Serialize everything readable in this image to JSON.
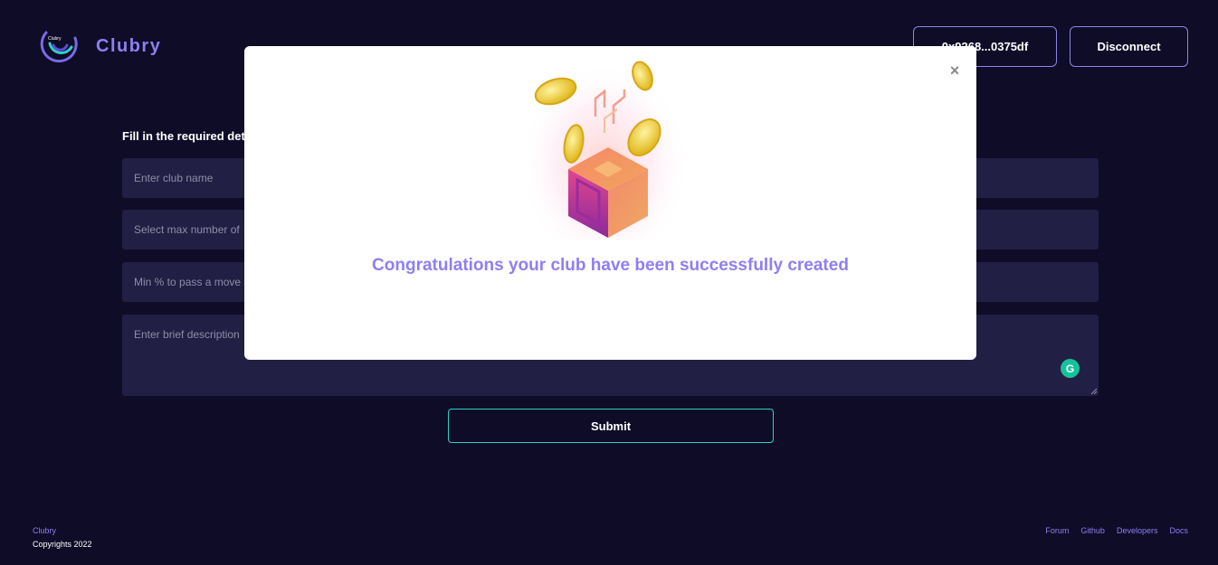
{
  "header": {
    "brand": "Clubry",
    "logo_text": "Clubry",
    "wallet_label": "0x9268...0375df",
    "disconnect_label": "Disconnect"
  },
  "form": {
    "heading": "Fill in the required deta",
    "club_name_placeholder": "Enter club name",
    "max_members_placeholder": "Select max number of",
    "min_percent_placeholder": "Min % to pass a move s",
    "description_placeholder": "Enter brief description",
    "submit_label": "Submit"
  },
  "modal": {
    "close_symbol": "×",
    "message": "Congratulations your club have been successfully created"
  },
  "footer": {
    "brand": "Clubry",
    "copyright": "Copyrights 2022",
    "links": [
      "Forum",
      "Github",
      "Developers",
      "Docs"
    ]
  },
  "colors": {
    "background": "#0e0c27",
    "accent": "#8e7ff2",
    "field": "#221f45",
    "submit_border": "#2fd1c5",
    "grammarly": "#15c39a"
  }
}
